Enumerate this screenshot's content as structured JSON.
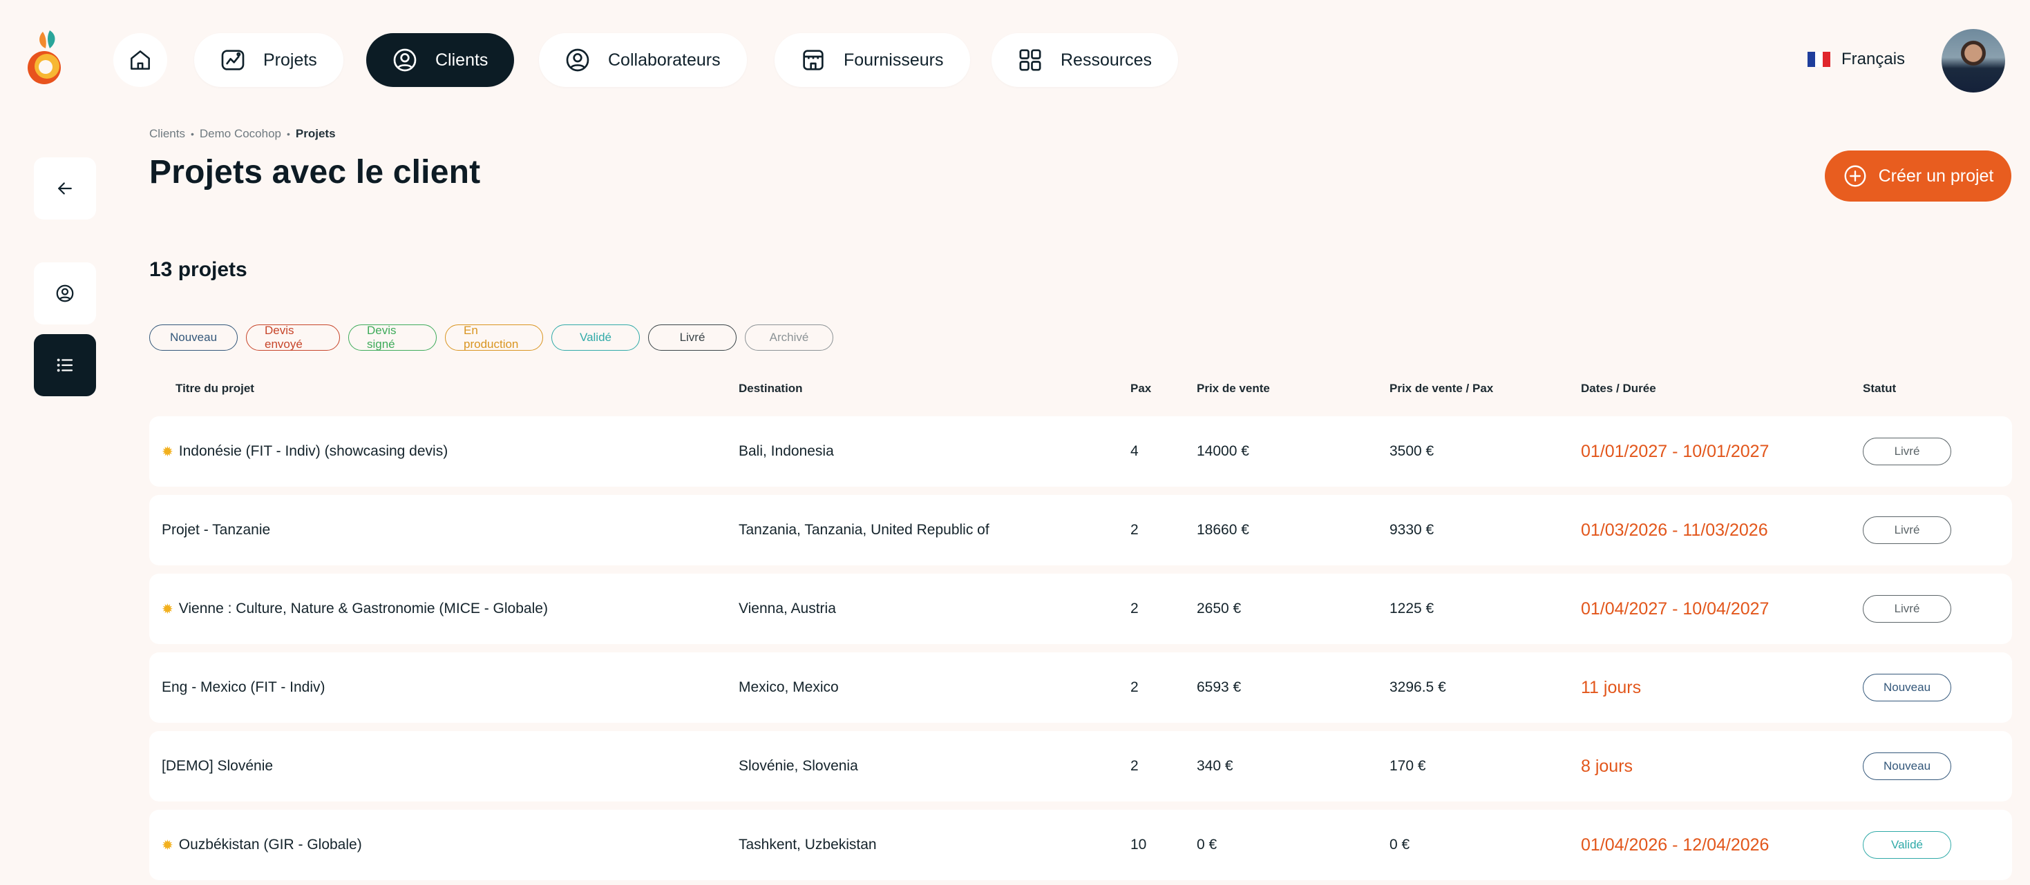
{
  "nav": {
    "items": [
      {
        "label": "Projets",
        "icon": "projects-icon",
        "active": false
      },
      {
        "label": "Clients",
        "icon": "user-circle-icon",
        "active": true
      },
      {
        "label": "Collaborateurs",
        "icon": "user-circle-icon",
        "active": false
      },
      {
        "label": "Fournisseurs",
        "icon": "store-icon",
        "active": false
      },
      {
        "label": "Ressources",
        "icon": "grid-icon",
        "active": false
      }
    ],
    "language": "Français"
  },
  "breadcrumb": [
    "Clients",
    "Demo Cocohop",
    "Projets"
  ],
  "page_title": "Projets avec le client",
  "create_button": "Créer un projet",
  "project_count": "13 projets",
  "filters": [
    {
      "label": "Nouveau",
      "color": "#33577a"
    },
    {
      "label": "Devis envoyé",
      "color": "#c7452a"
    },
    {
      "label": "Devis signé",
      "color": "#3eab5a"
    },
    {
      "label": "En production",
      "color": "#d99521"
    },
    {
      "label": "Validé",
      "color": "#30aaa8"
    },
    {
      "label": "Livré",
      "color": "#3a4347"
    },
    {
      "label": "Archivé",
      "color": "#8c9396"
    }
  ],
  "table": {
    "headers": {
      "title": "Titre du projet",
      "destination": "Destination",
      "pax": "Pax",
      "price": "Prix de vente",
      "price_pax": "Prix de vente / Pax",
      "dates": "Dates / Durée",
      "status": "Statut"
    },
    "rows": [
      {
        "sun": true,
        "title": "Indonésie (FIT - Indiv) (showcasing devis)",
        "destination": "Bali, Indonesia",
        "pax": "4",
        "price": "14000 €",
        "price_pax": "3500 €",
        "dates": "01/01/2027 - 10/01/2027",
        "status": "Livré",
        "status_color": "#5b6468"
      },
      {
        "sun": false,
        "title": "Projet - Tanzanie",
        "destination": "Tanzania, Tanzania, United Republic of",
        "pax": "2",
        "price": "18660 €",
        "price_pax": "9330 €",
        "dates": "01/03/2026 - 11/03/2026",
        "status": "Livré",
        "status_color": "#5b6468"
      },
      {
        "sun": true,
        "title": "Vienne : Culture, Nature & Gastronomie (MICE - Globale)",
        "destination": "Vienna, Austria",
        "pax": "2",
        "price": "2650 €",
        "price_pax": "1225 €",
        "dates": "01/04/2027 - 10/04/2027",
        "status": "Livré",
        "status_color": "#5b6468"
      },
      {
        "sun": false,
        "title": "Eng - Mexico (FIT - Indiv)",
        "destination": "Mexico, Mexico",
        "pax": "2",
        "price": "6593 €",
        "price_pax": "3296.5 €",
        "dates": "11 jours",
        "status": "Nouveau",
        "status_color": "#33577a"
      },
      {
        "sun": false,
        "title": "[DEMO] Slovénie",
        "destination": "Slovénie, Slovenia",
        "pax": "2",
        "price": "340 €",
        "price_pax": "170 €",
        "dates": "8 jours",
        "status": "Nouveau",
        "status_color": "#33577a"
      },
      {
        "sun": true,
        "title": "Ouzbékistan (GIR - Globale)",
        "destination": "Tashkent, Uzbekistan",
        "pax": "10",
        "price": "0 €",
        "price_pax": "0 €",
        "dates": "01/04/2026 - 12/04/2026",
        "status": "Validé",
        "status_color": "#30aaa8"
      }
    ]
  }
}
